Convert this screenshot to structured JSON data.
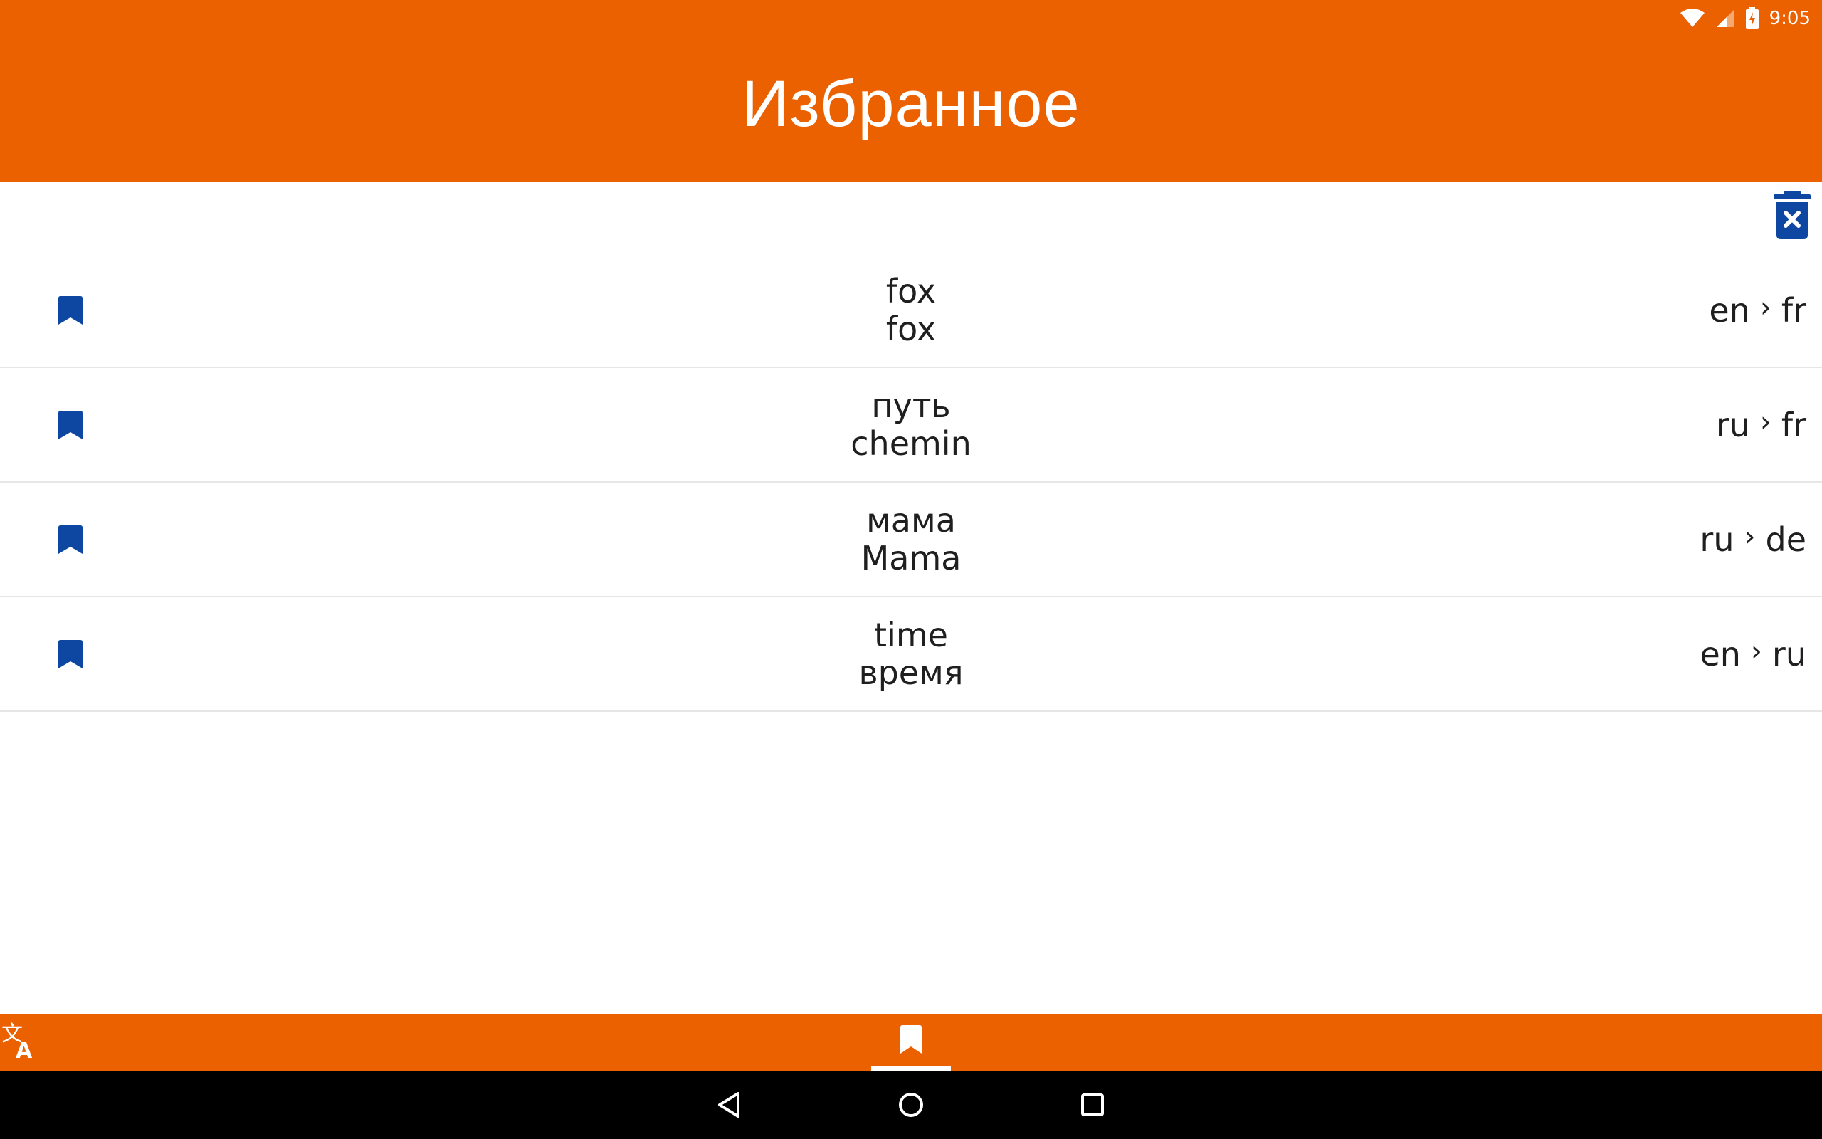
{
  "status_bar": {
    "time": "9:05",
    "icons": [
      "wifi-icon",
      "cell-signal-icon",
      "battery-charging-icon"
    ]
  },
  "header": {
    "title": "Избранное",
    "background_color": "#EB6100"
  },
  "toolbar": {
    "clear_icon": "delete-all-icon",
    "accent_color": "#0D47A1"
  },
  "favorites": [
    {
      "source": "fox",
      "translation": "fox",
      "from": "en",
      "to": "fr"
    },
    {
      "source": "путь",
      "translation": "chemin",
      "from": "ru",
      "to": "fr"
    },
    {
      "source": "мама",
      "translation": "Mama",
      "from": "ru",
      "to": "de"
    },
    {
      "source": "time",
      "translation": "время",
      "from": "en",
      "to": "ru"
    }
  ],
  "lang_separator": "›",
  "bottom_tabs": [
    {
      "icon": "translate-icon",
      "active": false
    },
    {
      "icon": "bookmark-icon",
      "active": true
    }
  ],
  "nav_bar": [
    "back-icon",
    "home-icon",
    "recents-icon"
  ]
}
